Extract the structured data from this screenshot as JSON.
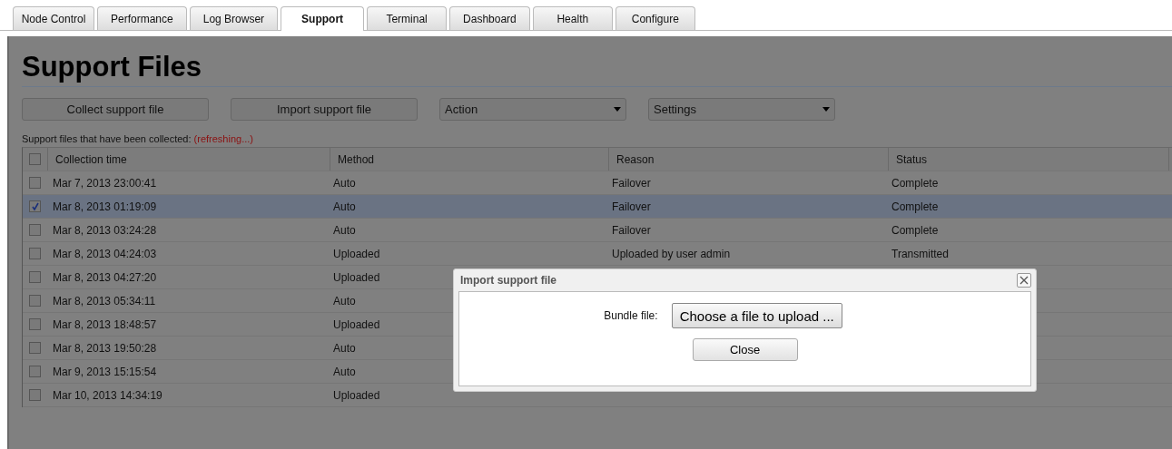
{
  "tabs": [
    {
      "label": "Node Control",
      "selected": false
    },
    {
      "label": "Performance",
      "selected": false
    },
    {
      "label": "Log Browser",
      "selected": false
    },
    {
      "label": "Support",
      "selected": true
    },
    {
      "label": "Terminal",
      "selected": false
    },
    {
      "label": "Dashboard",
      "selected": false
    },
    {
      "label": "Health",
      "selected": false
    },
    {
      "label": "Configure",
      "selected": false
    }
  ],
  "page": {
    "title": "Support Files",
    "buttons": [
      "Collect support file",
      "Import support file"
    ],
    "dropdowns": [
      "Action",
      "Settings"
    ],
    "caption": "Support files that have been collected:",
    "caption_status": "(refreshing...)"
  },
  "table": {
    "select_all_checked": false,
    "columns": [
      "Collection time",
      "Method",
      "Reason",
      "Status"
    ],
    "rows": [
      {
        "checked": false,
        "selected": false,
        "time": "Mar 7, 2013 23:00:41",
        "method": "Auto",
        "reason": "Failover",
        "status": "Complete"
      },
      {
        "checked": true,
        "selected": true,
        "time": "Mar 8, 2013 01:19:09",
        "method": "Auto",
        "reason": "Failover",
        "status": "Complete"
      },
      {
        "checked": false,
        "selected": false,
        "time": "Mar 8, 2013 03:24:28",
        "method": "Auto",
        "reason": "Failover",
        "status": "Complete"
      },
      {
        "checked": false,
        "selected": false,
        "time": "Mar 8, 2013 04:24:03",
        "method": "Uploaded",
        "reason": "Uploaded by user admin",
        "status": "Transmitted"
      },
      {
        "checked": false,
        "selected": false,
        "time": "Mar 8, 2013 04:27:20",
        "method": "Uploaded"
      },
      {
        "checked": false,
        "selected": false,
        "time": "Mar 8, 2013 05:34:11",
        "method": "Auto"
      },
      {
        "checked": false,
        "selected": false,
        "time": "Mar 8, 2013 18:48:57",
        "method": "Uploaded"
      },
      {
        "checked": false,
        "selected": false,
        "time": "Mar 8, 2013 19:50:28",
        "method": "Auto"
      },
      {
        "checked": false,
        "selected": false,
        "time": "Mar 9, 2013 15:15:54",
        "method": "Auto"
      },
      {
        "checked": false,
        "selected": false,
        "time": "Mar 10, 2013 14:34:19",
        "method": "Uploaded"
      }
    ]
  },
  "dialog": {
    "title": "Import support file",
    "field_label": "Bundle file:",
    "file_button": "Choose a file to upload ...",
    "close_button": "Close"
  }
}
